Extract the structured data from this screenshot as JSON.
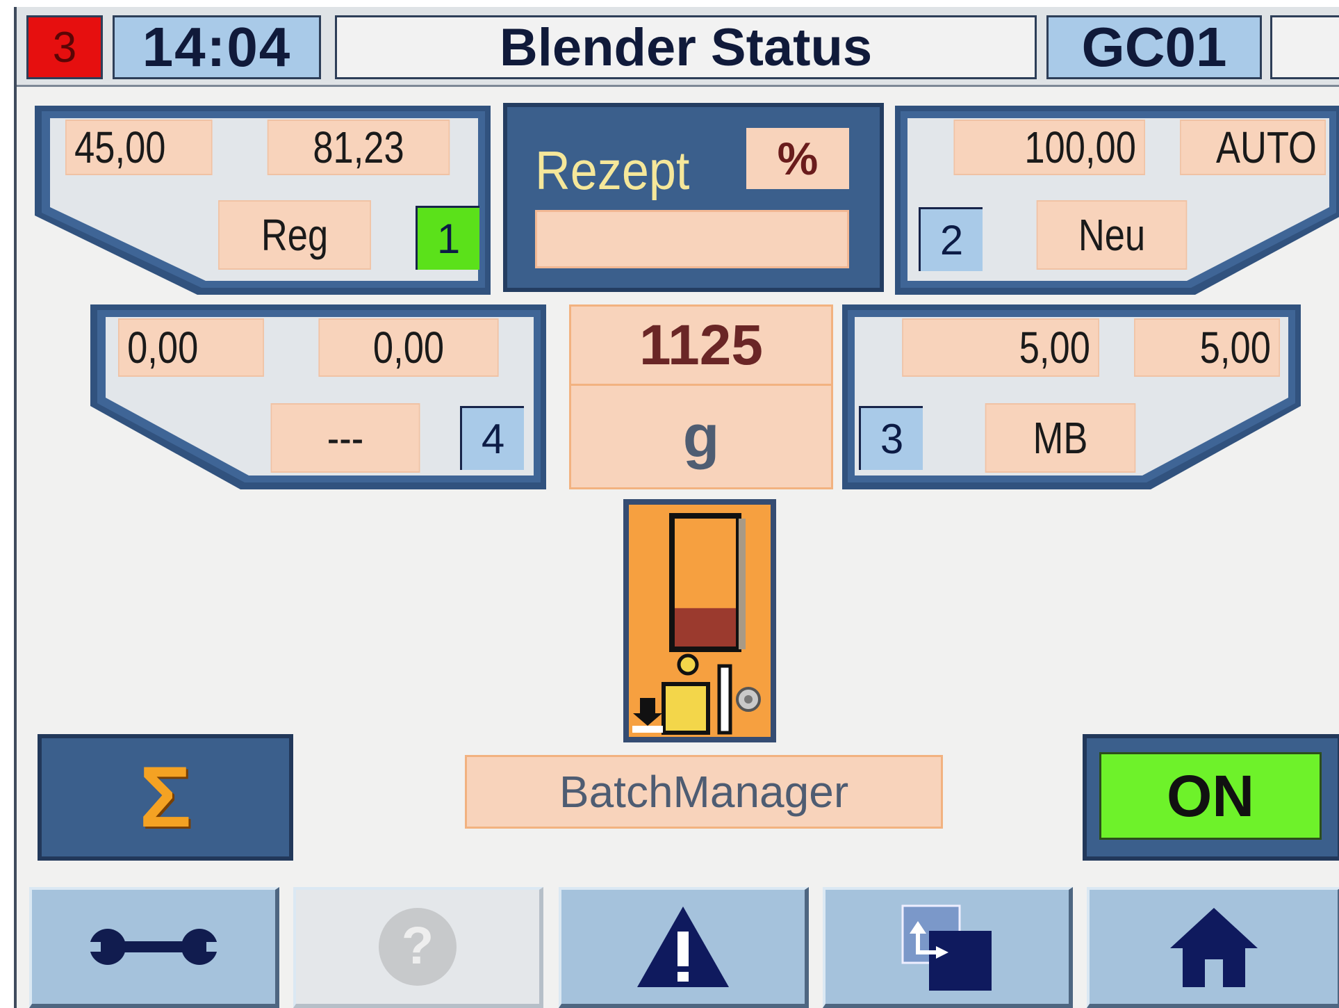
{
  "header": {
    "alarm_count": "3",
    "time": "14:04",
    "title": "Blender Status",
    "machine_id": "GC01"
  },
  "components": [
    {
      "number": "1",
      "value_1": "45,00",
      "value_2": "81,23",
      "material": "Reg",
      "status_color": "#5be11a"
    },
    {
      "number": "2",
      "value_1": "100,00",
      "value_2": "AUTO",
      "material": "Neu",
      "status_color": "#a9cae8"
    },
    {
      "number": "4",
      "value_1": "0,00",
      "value_2": "0,00",
      "material": "---",
      "status_color": "#a9cae8"
    },
    {
      "number": "3",
      "value_1": "5,00",
      "value_2": "5,00",
      "material": "MB",
      "status_color": "#a9cae8"
    }
  ],
  "recipe": {
    "label": "Rezept",
    "unit": "%",
    "value": ""
  },
  "batch_weight": {
    "value": "1125",
    "unit": "g"
  },
  "hopper": {
    "fill_fraction": 0.3,
    "icon": "scale-hopper-icon"
  },
  "batch_manager_label": "BatchManager",
  "sum_button": {
    "symbol": "Σ"
  },
  "on_button": {
    "label": "ON",
    "color": "#6ef22a"
  },
  "navigation": [
    {
      "icon": "wrench-icon",
      "enabled": true
    },
    {
      "icon": "help-icon",
      "enabled": false
    },
    {
      "icon": "alarm-warning-icon",
      "enabled": true
    },
    {
      "icon": "switch-screen-icon",
      "enabled": true
    },
    {
      "icon": "home-icon",
      "enabled": true
    }
  ],
  "colors": {
    "panel_blue": "#3b5f8c",
    "field_peach": "#f8d3bb",
    "header_blue": "#a9cae8",
    "alarm_red": "#e60f0f"
  }
}
